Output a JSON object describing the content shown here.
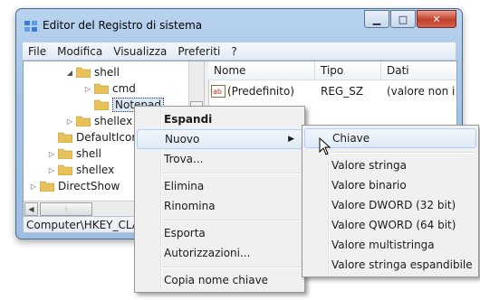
{
  "window": {
    "title": "Editor del Registro di sistema",
    "menu": [
      "File",
      "Modifica",
      "Visualizza",
      "Preferiti",
      "?"
    ],
    "caption_buttons": [
      "minimize-icon",
      "maximize-icon",
      "close-icon"
    ]
  },
  "tree": {
    "items": [
      {
        "label": "shell",
        "expanded": true
      },
      {
        "label": "cmd",
        "expanded": false
      },
      {
        "label": "Notepad",
        "selected": true
      },
      {
        "label": "shellex",
        "expanded": false
      },
      {
        "label": "DefaultIcon"
      },
      {
        "label": "shell",
        "expanded": false
      },
      {
        "label": "shellex",
        "expanded": false
      },
      {
        "label": "DirectShow",
        "expanded": false
      }
    ]
  },
  "list": {
    "headers": [
      "Nome",
      "Tipo",
      "Dati"
    ],
    "rows": [
      {
        "name": "(Predefinito)",
        "type": "REG_SZ",
        "data": "(valore non i"
      }
    ]
  },
  "status": {
    "path": "Computer\\HKEY_CLASS"
  },
  "context_menu": {
    "items": [
      "Espandi",
      "Nuovo",
      "Trova...",
      "Elimina",
      "Rinomina",
      "Esporta",
      "Autorizzazioni...",
      "Copia nome chiave"
    ]
  },
  "submenu": {
    "items": [
      "Chiave",
      "Valore stringa",
      "Valore binario",
      "Valore DWORD (32 bit)",
      "Valore QWORD (64 bit)",
      "Valore multistringa",
      "Valore stringa espandibile"
    ]
  },
  "colors": {
    "folder": "#e8c15a",
    "highlight_border": "#aecff7",
    "close_button": "#c2402a"
  }
}
